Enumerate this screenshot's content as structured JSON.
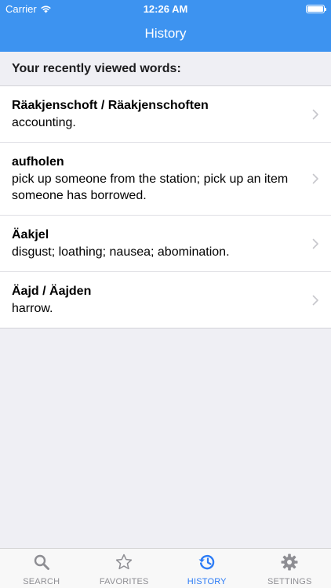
{
  "status_bar": {
    "carrier": "Carrier",
    "time": "12:26 AM"
  },
  "nav": {
    "title": "History"
  },
  "section_header": "Your recently viewed words:",
  "history_items": [
    {
      "word": "Räakjenschoft / Räakjenschoften",
      "definition": "accounting."
    },
    {
      "word": "aufholen",
      "definition": "pick up someone from the station; pick up an item someone has borrowed."
    },
    {
      "word": "Äakjel",
      "definition": "disgust; loathing; nausea; abomination."
    },
    {
      "word": "Äajd / Äajden",
      "definition": "harrow."
    }
  ],
  "tabs": [
    {
      "label": "SEARCH",
      "icon": "search-icon",
      "active": false
    },
    {
      "label": "FAVORITES",
      "icon": "star-icon",
      "active": false
    },
    {
      "label": "HISTORY",
      "icon": "history-icon",
      "active": true
    },
    {
      "label": "SETTINGS",
      "icon": "gear-icon",
      "active": false
    }
  ],
  "colors": {
    "nav_bar": "#3d93f0",
    "active_tab": "#2d7cf6",
    "inactive_tab": "#8e8e93",
    "background": "#efeff4"
  }
}
